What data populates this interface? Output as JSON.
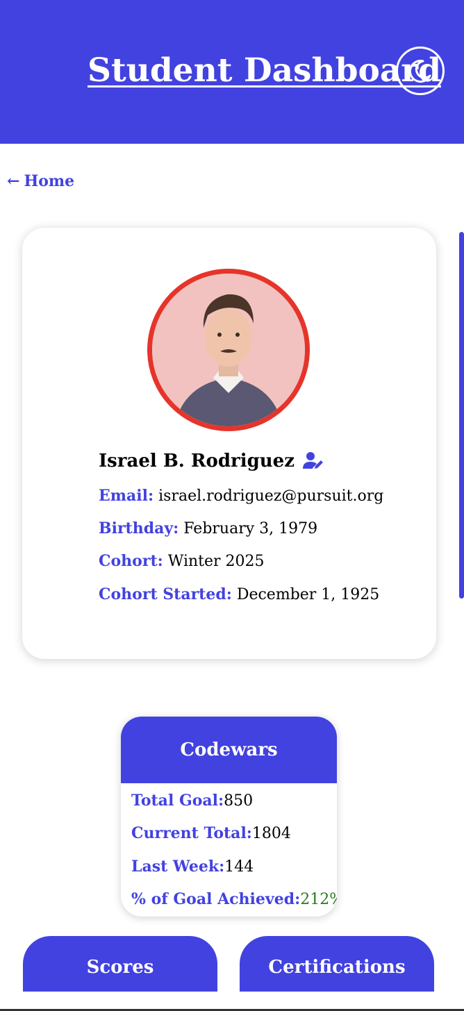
{
  "header": {
    "title": "Student Dashboard",
    "theme_toggle_icon": "moon-icon"
  },
  "nav": {
    "home_arrow": "←",
    "home_label": "Home"
  },
  "profile": {
    "name": "Israel B. Rodriguez",
    "edit_icon": "user-edit-icon",
    "email_label": "Email:",
    "email": "israel.rodriguez@pursuit.org",
    "birthday_label": "Birthday:",
    "birthday": "February 3, 1979",
    "cohort_label": "Cohort:",
    "cohort": "Winter 2025",
    "cohort_started_label": "Cohort Started:",
    "cohort_started": "December 1, 1925"
  },
  "codewars": {
    "title": "Codewars",
    "total_goal_label": "Total Goal:",
    "total_goal": "850",
    "current_total_label": "Current Total:",
    "current_total": "1804",
    "last_week_label": "Last Week:",
    "last_week": "144",
    "percent_label": "% of Goal Achieved:",
    "percent": "212%"
  },
  "cards": {
    "scores_title": "Scores",
    "certifications_title": "Certifications"
  },
  "colors": {
    "brand": "#4242e0",
    "avatar_ring": "#e5352b",
    "success": "#2a7a1e"
  }
}
